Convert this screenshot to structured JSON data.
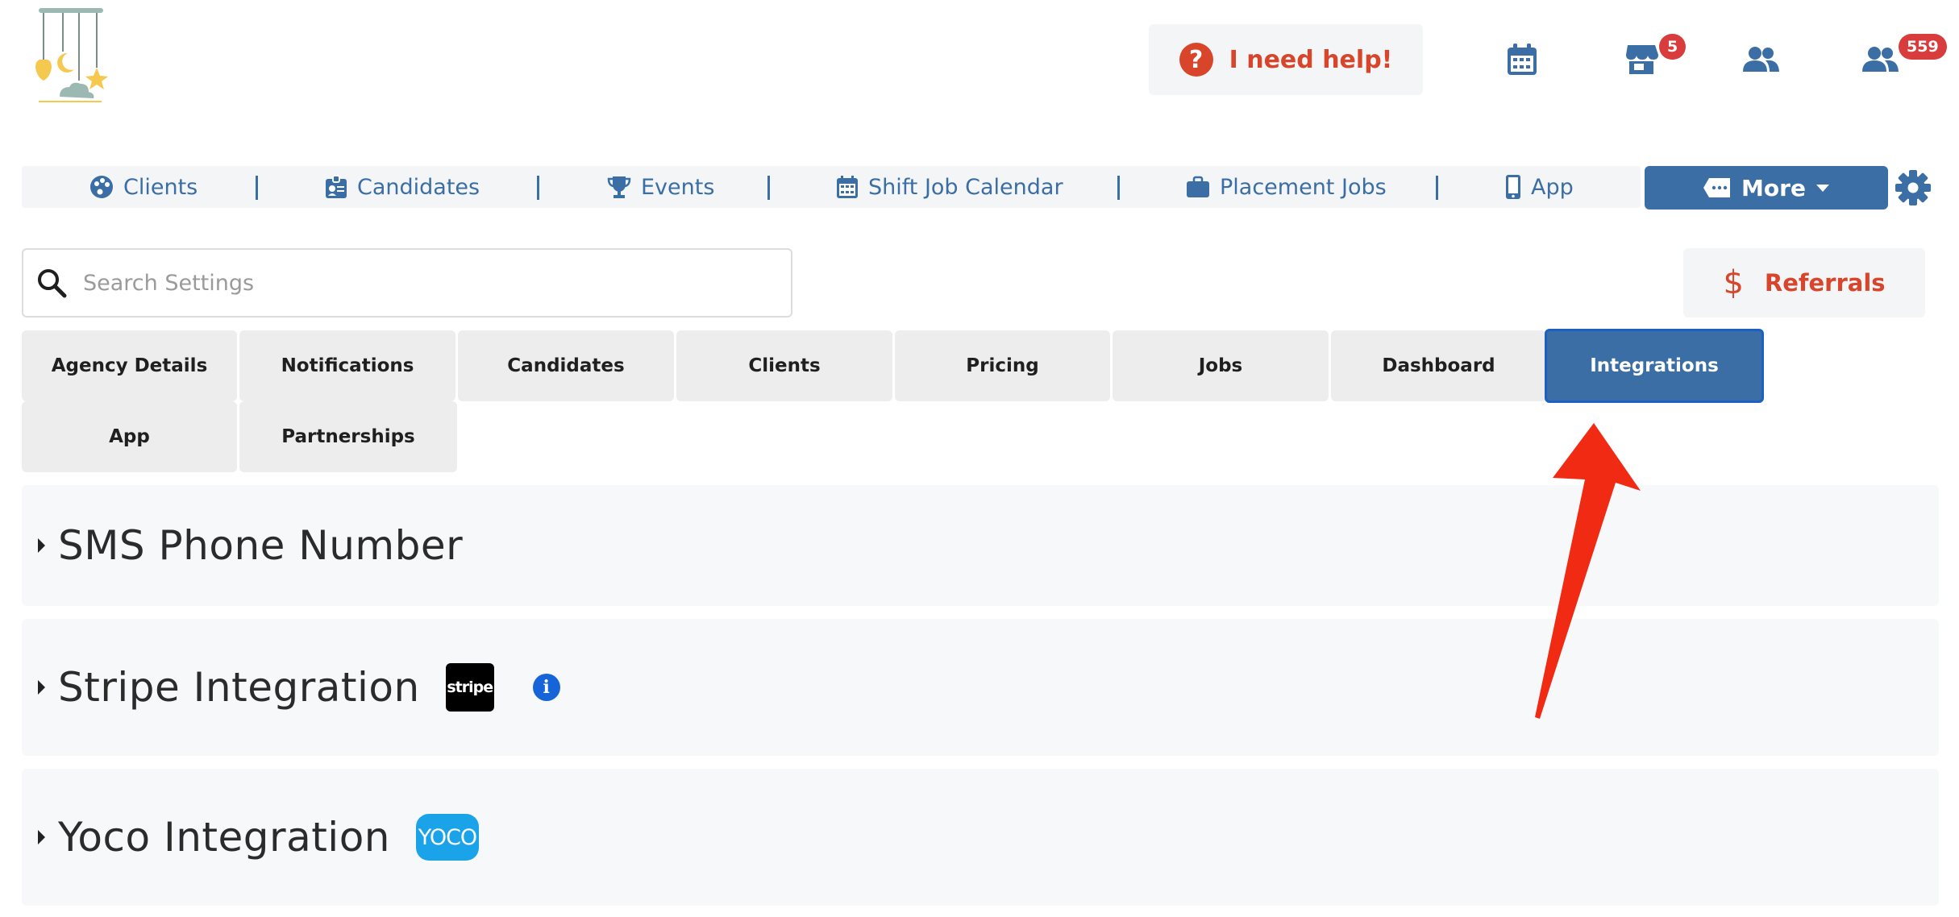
{
  "header": {
    "help_label": "I need help!",
    "help_icon": "question-circle-icon",
    "icons": [
      {
        "name": "calendar-icon"
      },
      {
        "name": "store-icon",
        "badge": "5"
      },
      {
        "name": "users-icon"
      },
      {
        "name": "users-alert-icon",
        "badge": "559"
      }
    ]
  },
  "nav": {
    "items": [
      {
        "label": "Clients",
        "icon": "palette-icon"
      },
      {
        "label": "Candidates",
        "icon": "id-badge-icon"
      },
      {
        "label": "Events",
        "icon": "trophy-icon"
      },
      {
        "label": "Shift Job Calendar",
        "icon": "calendar-icon"
      },
      {
        "label": "Placement Jobs",
        "icon": "briefcase-icon"
      },
      {
        "label": "App",
        "icon": "mobile-icon"
      }
    ],
    "more_label": "More"
  },
  "search": {
    "placeholder": "Search Settings",
    "value": ""
  },
  "referrals": {
    "label": "Referrals"
  },
  "tabs": [
    {
      "label": "Agency Details",
      "active": false
    },
    {
      "label": "Notifications",
      "active": false
    },
    {
      "label": "Candidates",
      "active": false
    },
    {
      "label": "Clients",
      "active": false
    },
    {
      "label": "Pricing",
      "active": false
    },
    {
      "label": "Jobs",
      "active": false
    },
    {
      "label": "Dashboard",
      "active": false
    },
    {
      "label": "Integrations",
      "active": true
    },
    {
      "label": "App",
      "active": false
    },
    {
      "label": "Partnerships",
      "active": false
    }
  ],
  "sections": [
    {
      "title": "SMS Phone Number"
    },
    {
      "title": "Stripe Integration",
      "logo_text": "stripe"
    },
    {
      "title": "Yoco Integration",
      "logo_text": "YOCO"
    }
  ],
  "colors": {
    "brand_blue": "#3a6ea5",
    "accent_red": "#d9452b",
    "badge_red": "#d93c3c",
    "arrow_red": "#f12a14"
  }
}
